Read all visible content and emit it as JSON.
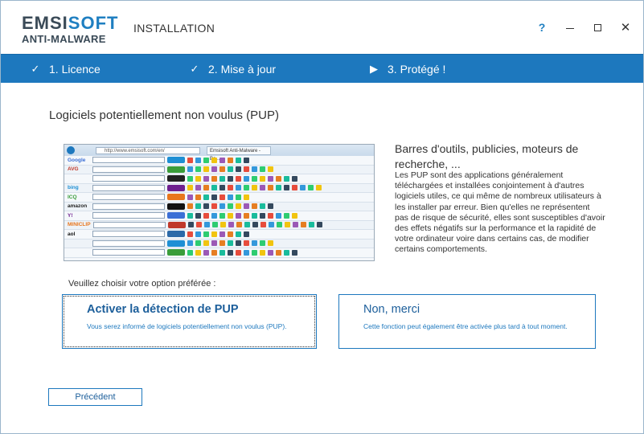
{
  "app": {
    "logo_main_left": "EMSI",
    "logo_main_right": "SOFT",
    "logo_sub": "ANTI-MALWARE",
    "screen_title": "INSTALLATION"
  },
  "window_controls": {
    "help": "?",
    "close": "✕"
  },
  "steps": [
    {
      "icon": "check-icon",
      "label": "1. Licence"
    },
    {
      "icon": "check-icon",
      "label": "2. Mise à jour"
    },
    {
      "icon": "play-icon",
      "label": "3. Protégé !"
    }
  ],
  "main": {
    "heading": "Logiciels potentiellement non voulus (PUP)",
    "pup_title": "Barres d'outils, publicies, moteurs de recherche, ...",
    "pup_description": "Les PUP sont des applications généralement téléchargées et installées conjointement à d'autres logiciels utiles, ce qui même de nombreux utilisateurs à les installer par erreur. Bien qu'elles ne représentent pas de risque de sécurité, elles sont susceptibles d'avoir des effets négatifs sur la performance et la rapidité de votre ordinateur voire dans certains cas, de modifier certains comportements.",
    "choose_label": "Veuillez choisir votre option préférée :"
  },
  "screenshot_thumb": {
    "address": "http://www.emsisoft.com/en/",
    "tab_title": "Emsisoft Anti-Malware - Be...",
    "toolbar_brands": [
      "Google",
      "AVG",
      "",
      "bing",
      "ICQ",
      "amazon",
      "Y!",
      "MINICLIP",
      "aol"
    ],
    "colors": {
      "google": "#3b6fd6",
      "avg": "#c0392b",
      "bing": "#1e8fd4",
      "amazon": "#222222",
      "yahoo": "#6e1f8f",
      "miniclip": "#e8761d",
      "aol": "#111111"
    }
  },
  "options": {
    "pup": {
      "title": "Activer la détection de PUP",
      "description": "Vous serez informé de logiciels potentiellement non voulus (PUP)."
    },
    "no": {
      "title": "Non, merci",
      "description": "Cette fonction peut également être activée plus tard à tout moment."
    }
  },
  "footer": {
    "previous_label": "Précédent"
  },
  "colors": {
    "accent": "#1d78be",
    "accent_dark": "#1d5f9b",
    "logo_text": "#3a4a57"
  }
}
